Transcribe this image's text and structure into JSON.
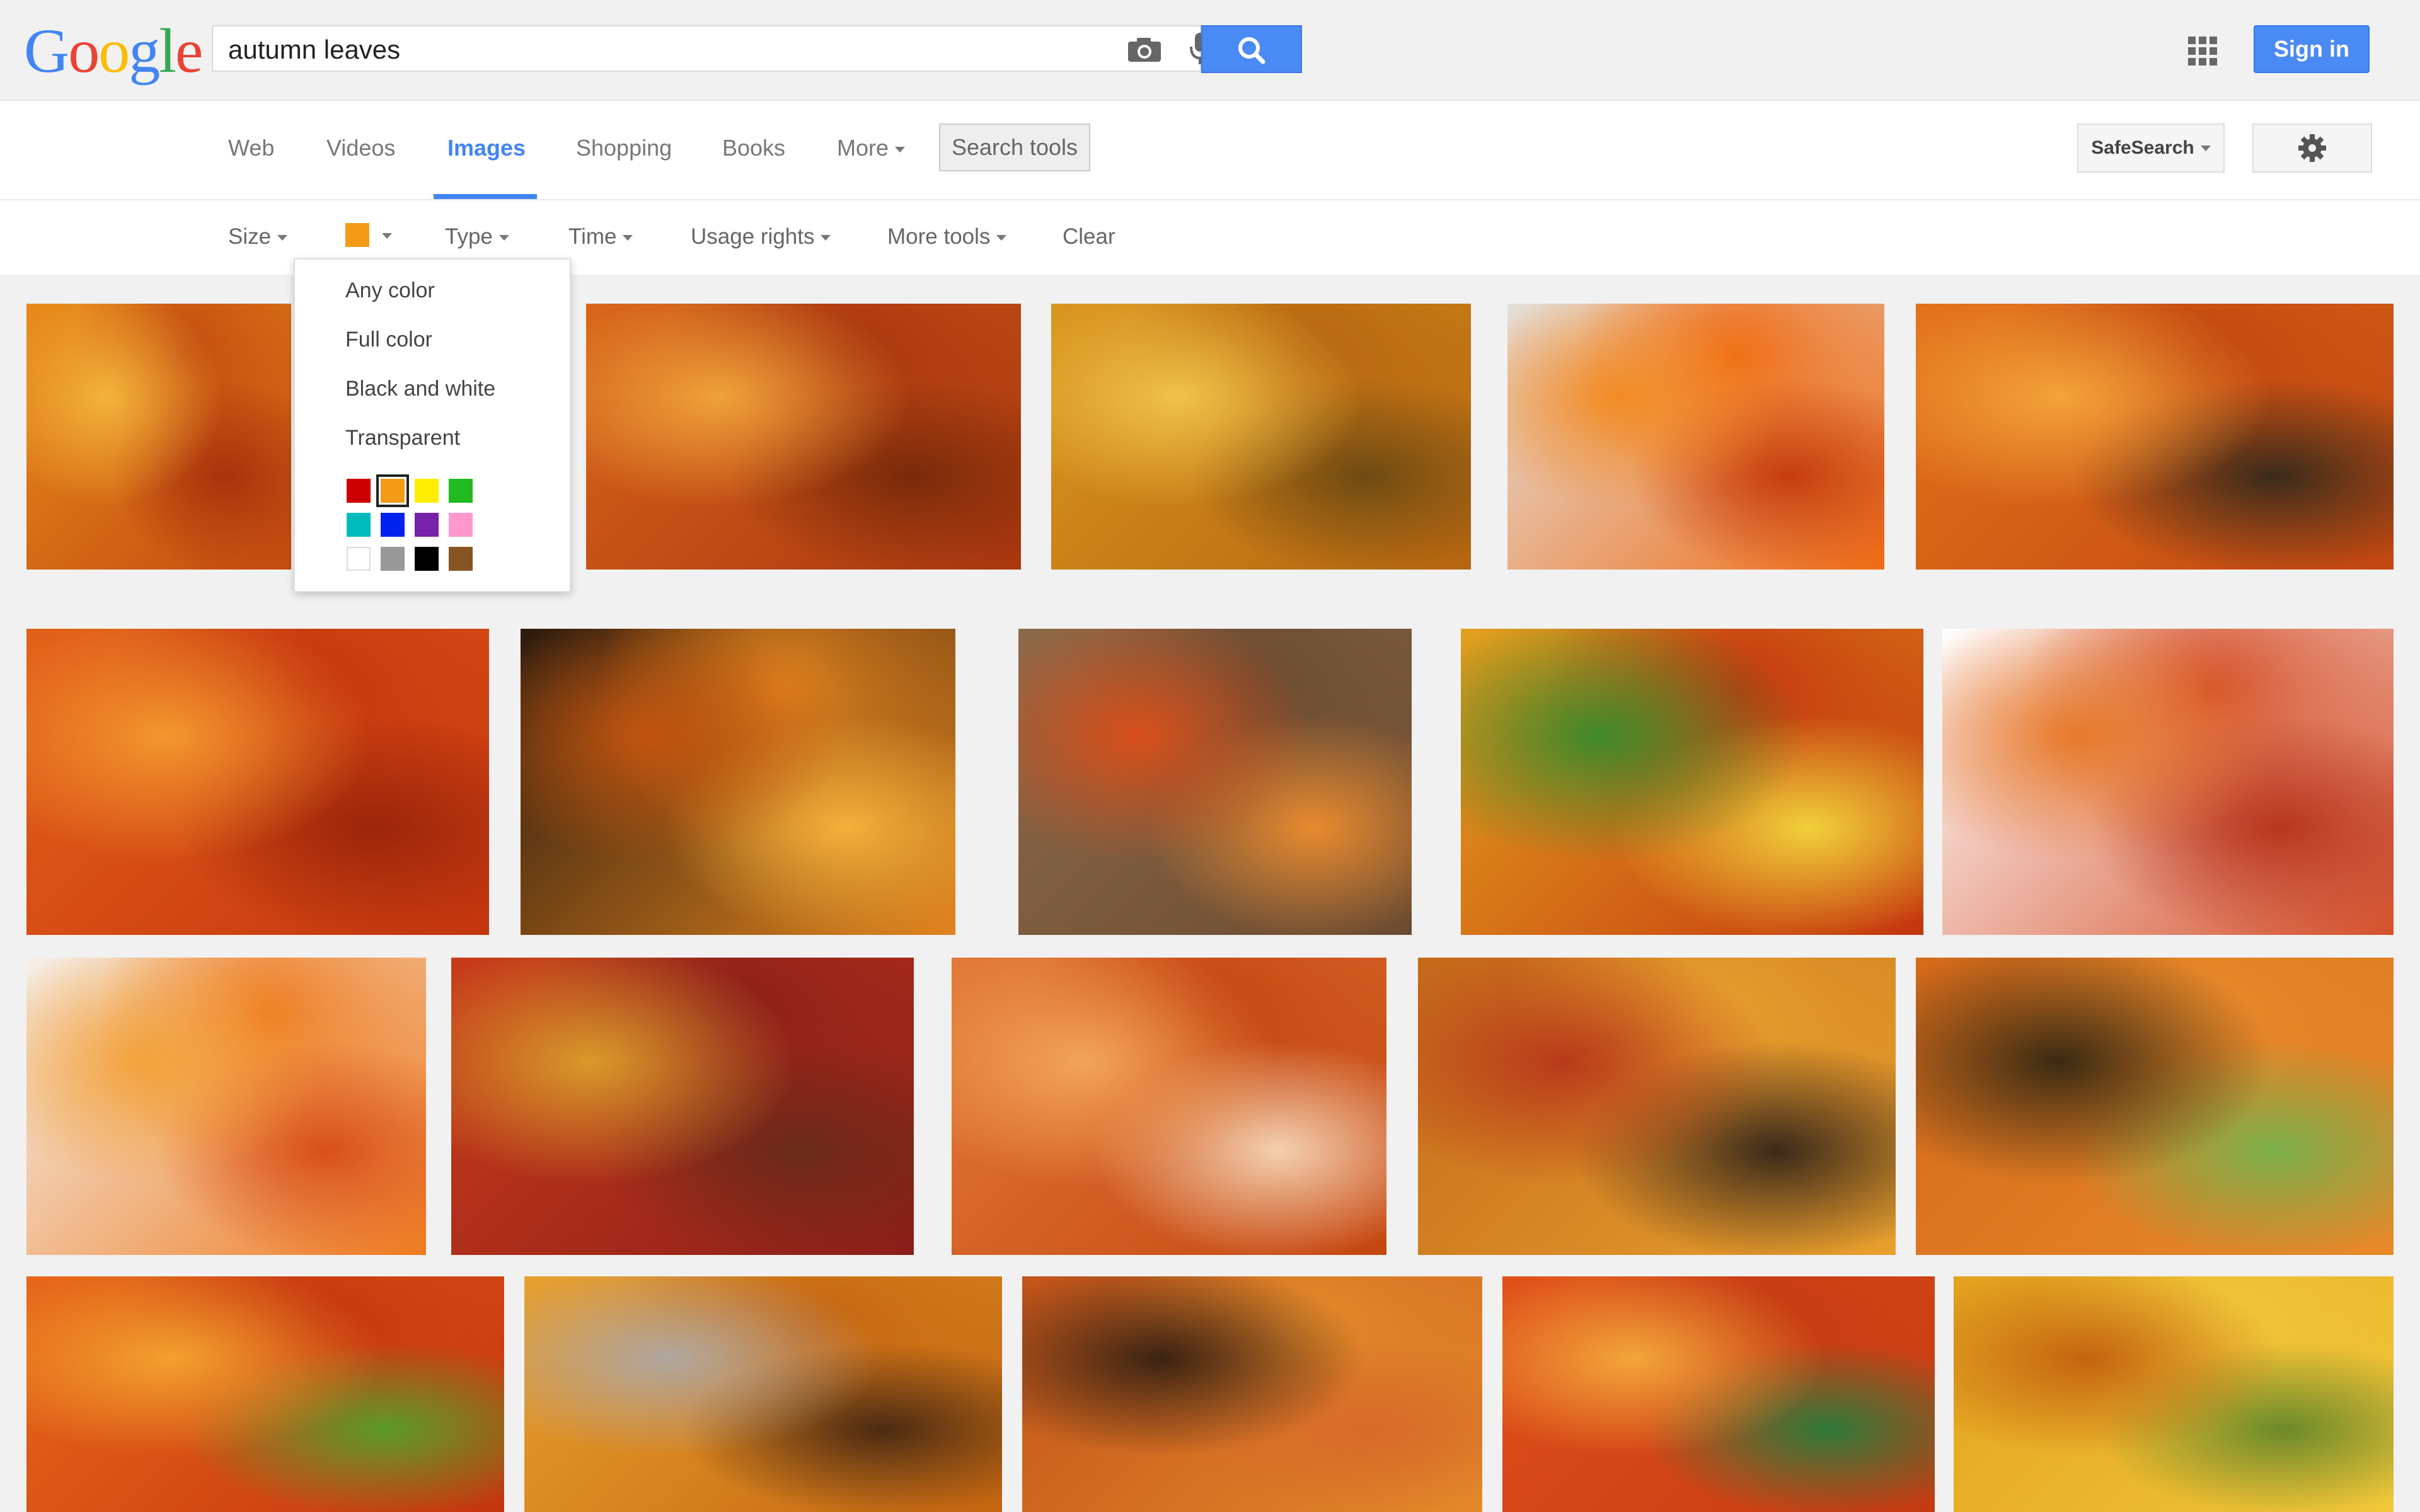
{
  "logo": {
    "letters": [
      "G",
      "o",
      "o",
      "g",
      "l",
      "e"
    ],
    "colors": [
      "#4285f4",
      "#ea4335",
      "#fbbc05",
      "#4285f4",
      "#34a853",
      "#ea4335"
    ]
  },
  "search": {
    "query": "autumn leaves"
  },
  "header": {
    "signin_label": "Sign in"
  },
  "nav": {
    "items": [
      "Web",
      "Videos",
      "Images",
      "Shopping",
      "Books",
      "More"
    ],
    "active": "Images",
    "search_tools": "Search tools",
    "safesearch": "SafeSearch"
  },
  "tools": {
    "size": "Size",
    "color_selected": "#f39b16",
    "type": "Type",
    "time": "Time",
    "usage_rights": "Usage rights",
    "more_tools": "More tools",
    "clear": "Clear"
  },
  "color_menu": {
    "options": [
      "Any color",
      "Full color",
      "Black and white",
      "Transparent"
    ],
    "swatches": [
      [
        "#cc0000",
        "#f39b16",
        "#ffee00",
        "#22bb22"
      ],
      [
        "#00bbbb",
        "#0022ee",
        "#7722aa",
        "#ff99cc"
      ],
      [
        "#ffffff",
        "#999999",
        "#000000",
        "#885522"
      ]
    ],
    "selected_swatch": "#f39b16"
  },
  "images": {
    "rows": [
      [
        {
          "name": "image-result-1",
          "palette": [
            "#e88a1a",
            "#c24b10",
            "#f3b33a",
            "#a8320c"
          ]
        },
        {
          "name": "image-result-2",
          "palette": [
            "#d8651a",
            "#a8350f",
            "#f0a23a",
            "#7a2a0a"
          ]
        },
        {
          "name": "image-result-3",
          "palette": [
            "#d9961f",
            "#b6640f",
            "#f0c248",
            "#6e4a12"
          ]
        },
        {
          "name": "image-result-4",
          "palette": [
            "#e4e0db",
            "#ef6a12",
            "#f28b23",
            "#c63d0b"
          ]
        },
        {
          "name": "image-result-5",
          "palette": [
            "#e3731b",
            "#c14610",
            "#f4a33a",
            "#3a2a1a"
          ]
        }
      ],
      [
        {
          "name": "image-result-6",
          "palette": [
            "#e3601a",
            "#c4350e",
            "#f3962e",
            "#9b240a"
          ]
        },
        {
          "name": "image-result-7",
          "palette": [
            "#2b1a0e",
            "#e2841e",
            "#c2540f",
            "#f3b03a"
          ]
        },
        {
          "name": "image-result-8",
          "palette": [
            "#8b6a4a",
            "#6b4a30",
            "#d8501a",
            "#e88a2e"
          ]
        },
        {
          "name": "image-result-9",
          "palette": [
            "#e3a11e",
            "#c4350e",
            "#3f8a2a",
            "#f1d03a"
          ]
        },
        {
          "name": "image-result-10",
          "palette": [
            "#ffffff",
            "#d4502a",
            "#e77a2a",
            "#b8351e"
          ]
        }
      ],
      [
        {
          "name": "image-result-11",
          "palette": [
            "#f4f0ea",
            "#ee7a1e",
            "#f3a23a",
            "#d8501a"
          ]
        },
        {
          "name": "image-result-12",
          "palette": [
            "#c83a1a",
            "#8a1e1a",
            "#d99a2a",
            "#6a2a1a"
          ]
        },
        {
          "name": "image-result-13",
          "palette": [
            "#e27a3a",
            "#c4450f",
            "#f3a45a",
            "#f3d0b0"
          ]
        },
        {
          "name": "image-result-14",
          "palette": [
            "#c46a1a",
            "#e8a02e",
            "#b83a1a",
            "#3a2a1a"
          ]
        },
        {
          "name": "image-result-15",
          "palette": [
            "#d56a1a",
            "#e88a2a",
            "#3a2a12",
            "#7bb04a"
          ]
        }
      ],
      [
        {
          "name": "image-result-16",
          "palette": [
            "#e7671a",
            "#c4350e",
            "#f3a12e",
            "#5a9a2a"
          ]
        },
        {
          "name": "image-result-17",
          "palette": [
            "#e8a02e",
            "#c4640f",
            "#b0a8a0",
            "#4a2a12"
          ]
        },
        {
          "name": "image-result-18",
          "palette": [
            "#c4541a",
            "#e48a2a",
            "#3a2212",
            "#d86a2a"
          ]
        },
        {
          "name": "image-result-19",
          "palette": [
            "#e0501a",
            "#c43a12",
            "#f3a63a",
            "#2f7a3a"
          ]
        },
        {
          "name": "image-result-20",
          "palette": [
            "#e3a11e",
            "#f1c83a",
            "#c4640f",
            "#6a8a2a"
          ]
        }
      ]
    ]
  }
}
